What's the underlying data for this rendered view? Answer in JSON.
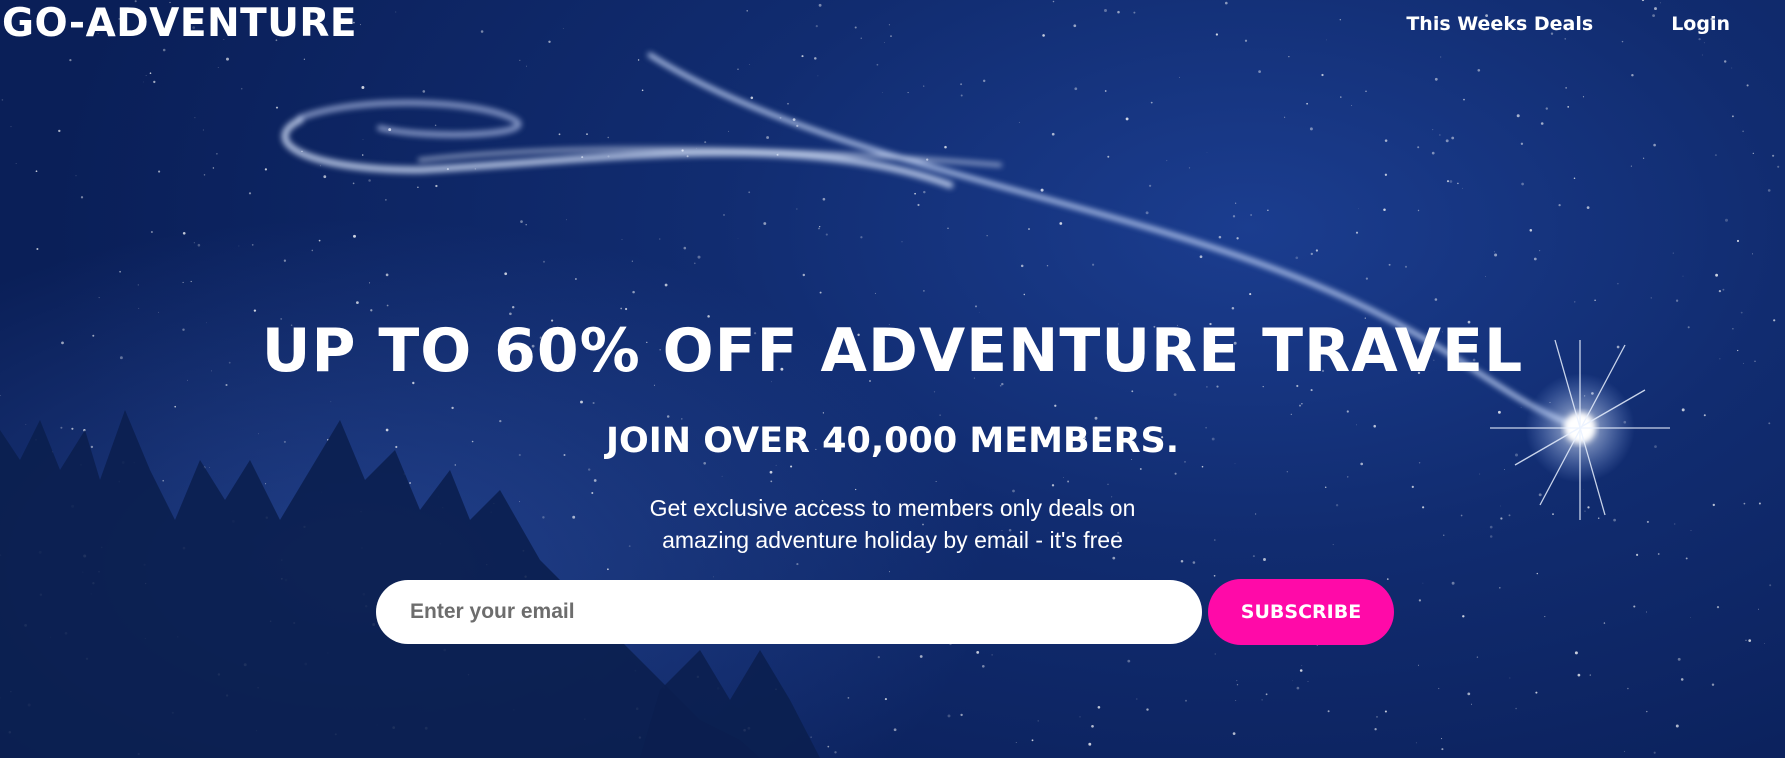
{
  "nav": {
    "logo": "GO-ADVENTURE",
    "links": [
      {
        "label": "This Weeks Deals"
      },
      {
        "label": "Login"
      }
    ]
  },
  "hero": {
    "headline": "UP TO 60% OFF ADVENTURE TRAVEL",
    "subheadline": "JOIN OVER 40,000 MEMBERS.",
    "description_line1": "Get exclusive access to members only deals on",
    "description_line2": "amazing adventure holiday by email - it's free"
  },
  "signup": {
    "email_placeholder": "Enter your email",
    "email_value": "",
    "button_label": "SUBSCRIBE"
  },
  "colors": {
    "background": "#0f2a6b",
    "accent": "#ff0aa8",
    "text": "#ffffff"
  }
}
